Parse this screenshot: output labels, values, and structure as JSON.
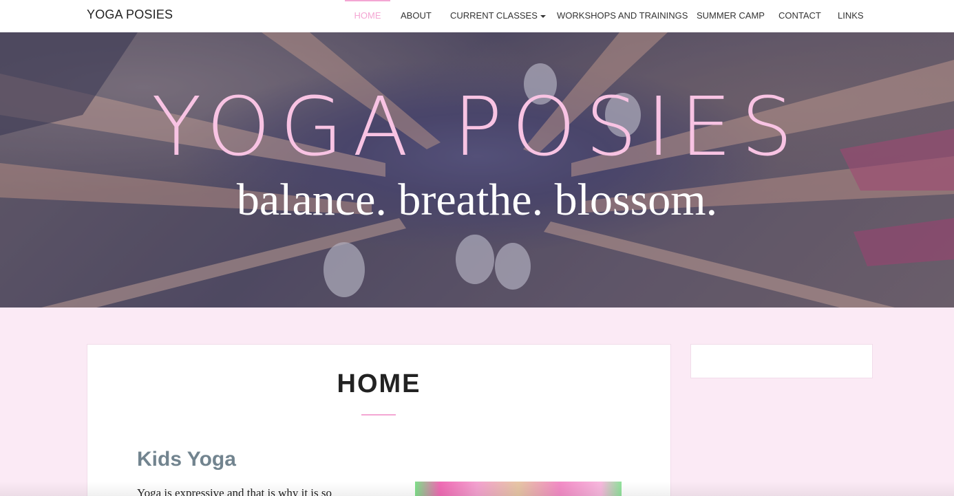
{
  "navbar": {
    "brand": "YOGA POSIES",
    "items": [
      {
        "label": "HOME",
        "active": true
      },
      {
        "label": "ABOUT"
      },
      {
        "label": "CURRENT CLASSES",
        "dropdown": true
      },
      {
        "label": "WORKSHOPS AND TRAININGS"
      },
      {
        "label": "SUMMER CAMP"
      },
      {
        "label": "CONTACT"
      },
      {
        "label": "LINKS"
      }
    ]
  },
  "hero": {
    "title": "YOGA POSIES",
    "tagline": "balance. breathe. blossom."
  },
  "main": {
    "page_title": "HOME",
    "section_heading": "Kids Yoga",
    "intro_text": "Yoga is expressive and that is why it is so"
  },
  "colors": {
    "accent": "#f4a6d3",
    "page_background": "#fbeaf5",
    "heading": "#72848f"
  },
  "icons": {
    "dropdown": "caret-down-icon"
  }
}
